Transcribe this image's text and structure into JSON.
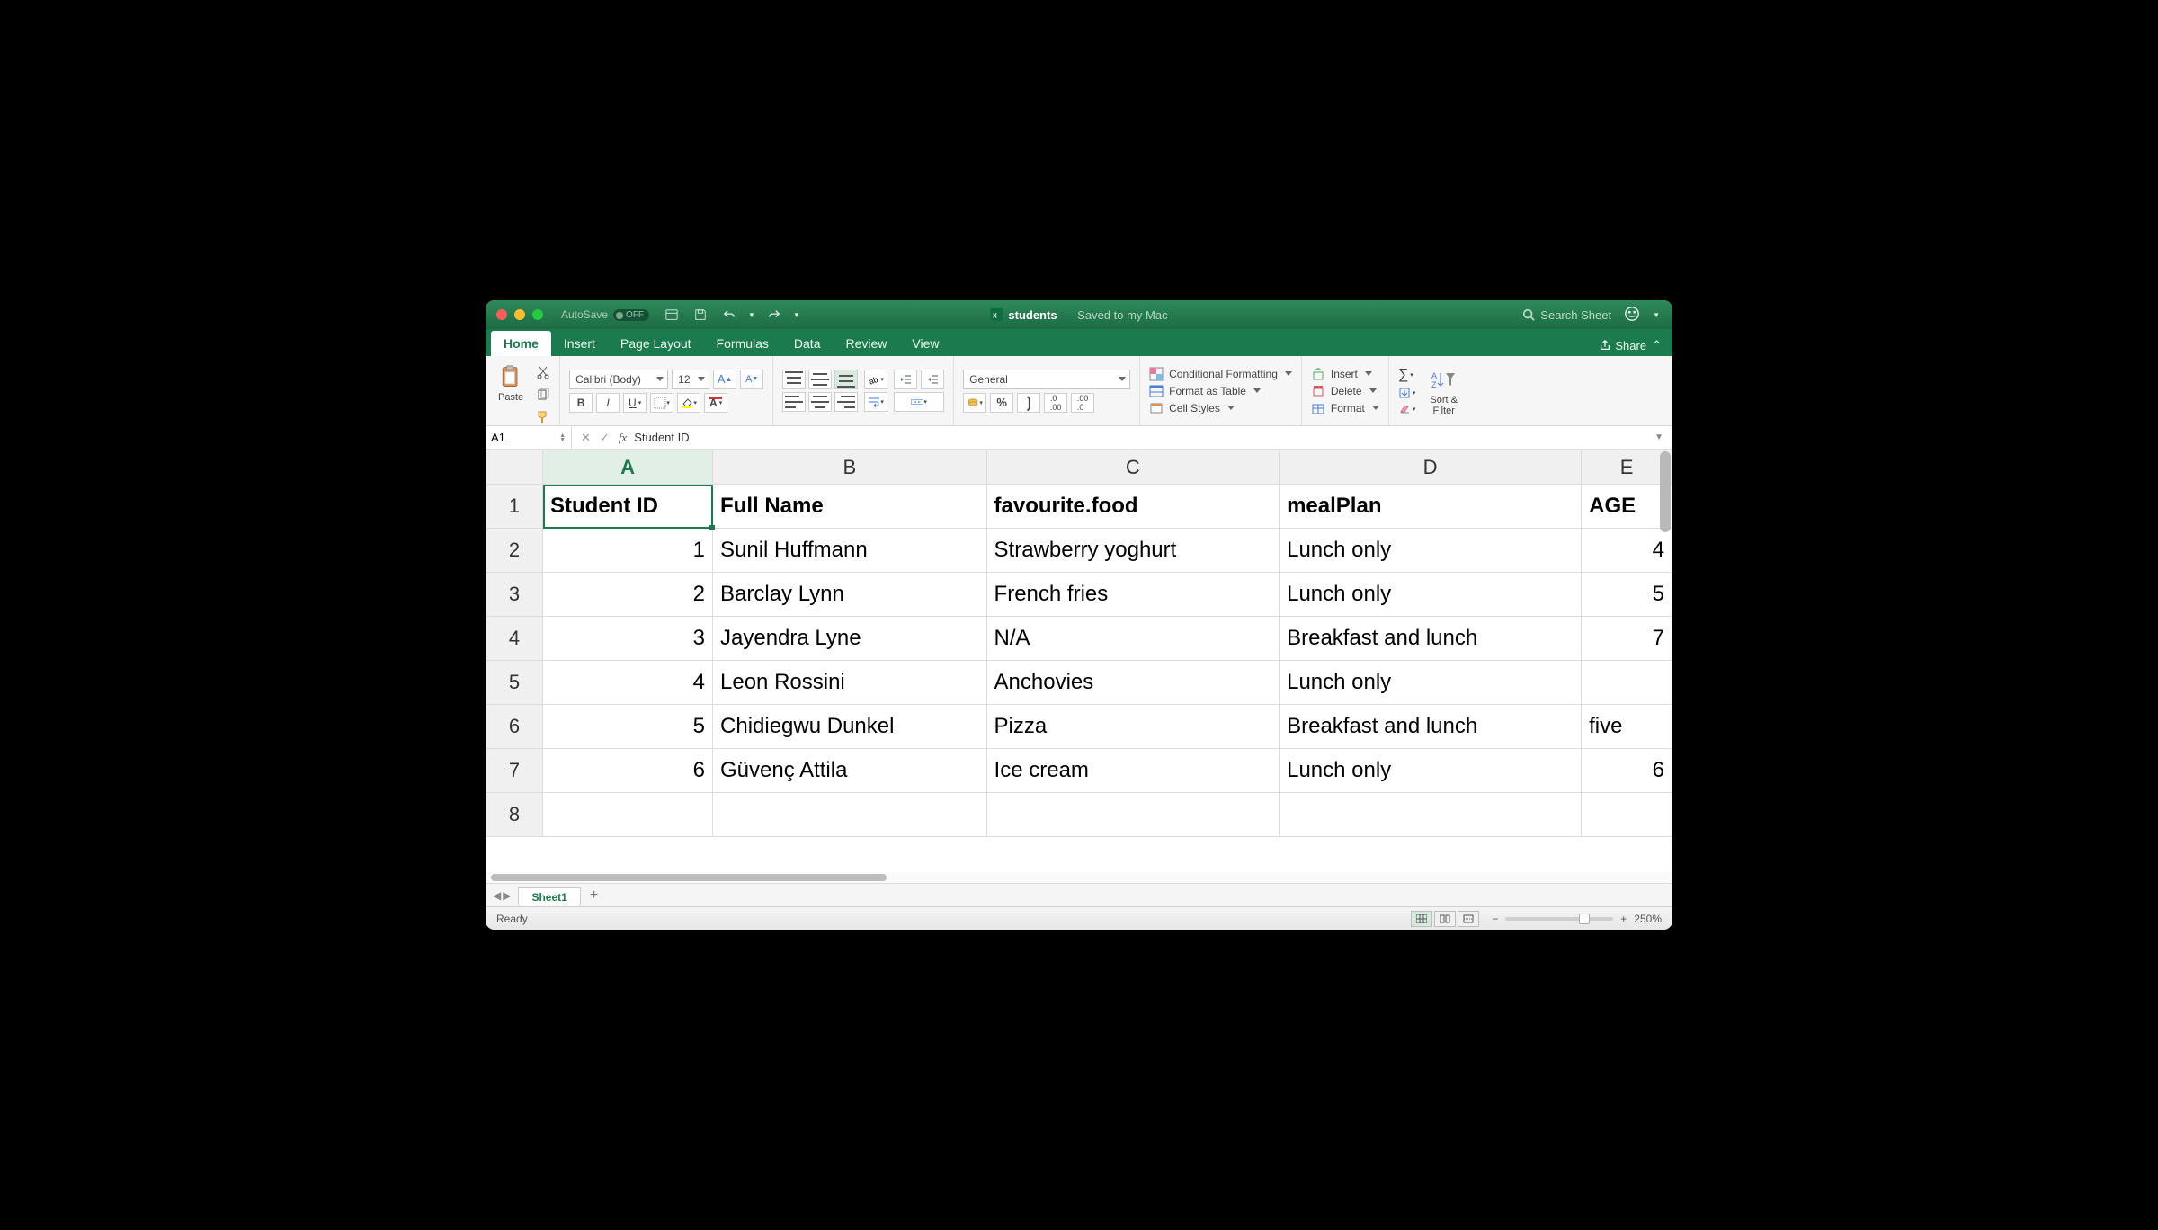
{
  "window": {
    "autosave_label": "AutoSave",
    "autosave_state": "OFF",
    "doc_name": "students",
    "doc_status": "— Saved to my Mac",
    "search_placeholder": "Search Sheet"
  },
  "tabs": {
    "items": [
      "Home",
      "Insert",
      "Page Layout",
      "Formulas",
      "Data",
      "Review",
      "View"
    ],
    "active": "Home",
    "share_label": "Share"
  },
  "ribbon": {
    "paste_label": "Paste",
    "font_name": "Calibri (Body)",
    "font_size": "12",
    "number_format": "General",
    "cond_fmt": "Conditional Formatting",
    "fmt_table": "Format as Table",
    "cell_styles": "Cell Styles",
    "insert": "Insert",
    "delete": "Delete",
    "format": "Format",
    "sort_filter": "Sort &\nFilter"
  },
  "namebox": {
    "ref": "A1",
    "formula": "Student ID"
  },
  "sheet": {
    "columns": [
      "A",
      "B",
      "C",
      "D",
      "E"
    ],
    "active_col": "A",
    "active_row": 1,
    "headers": [
      "Student ID",
      "Full Name",
      "favourite.food",
      "mealPlan",
      "AGE"
    ],
    "rows": [
      {
        "id": "1",
        "name": "Sunil Huffmann",
        "food": "Strawberry yoghurt",
        "plan": "Lunch only",
        "age": "4"
      },
      {
        "id": "2",
        "name": "Barclay Lynn",
        "food": "French fries",
        "plan": "Lunch only",
        "age": "5"
      },
      {
        "id": "3",
        "name": "Jayendra Lyne",
        "food": "N/A",
        "plan": "Breakfast and lunch",
        "age": "7"
      },
      {
        "id": "4",
        "name": "Leon Rossini",
        "food": "Anchovies",
        "plan": "Lunch only",
        "age": ""
      },
      {
        "id": "5",
        "name": "Chidiegwu Dunkel",
        "food": "Pizza",
        "plan": "Breakfast and lunch",
        "age": "five"
      },
      {
        "id": "6",
        "name": "Güvenç Attila",
        "food": "Ice cream",
        "plan": "Lunch only",
        "age": "6"
      }
    ],
    "row_numbers": [
      "1",
      "2",
      "3",
      "4",
      "5",
      "6",
      "7",
      "8"
    ]
  },
  "footer": {
    "sheet_tab": "Sheet1",
    "status": "Ready",
    "zoom": "250%"
  },
  "chart_data": {
    "type": "table",
    "columns": [
      "Student ID",
      "Full Name",
      "favourite.food",
      "mealPlan",
      "AGE"
    ],
    "rows": [
      [
        1,
        "Sunil Huffmann",
        "Strawberry yoghurt",
        "Lunch only",
        4
      ],
      [
        2,
        "Barclay Lynn",
        "French fries",
        "Lunch only",
        5
      ],
      [
        3,
        "Jayendra Lyne",
        "N/A",
        "Breakfast and lunch",
        7
      ],
      [
        4,
        "Leon Rossini",
        "Anchovies",
        "Lunch only",
        null
      ],
      [
        5,
        "Chidiegwu Dunkel",
        "Pizza",
        "Breakfast and lunch",
        "five"
      ],
      [
        6,
        "Güvenç Attila",
        "Ice cream",
        "Lunch only",
        6
      ]
    ]
  }
}
